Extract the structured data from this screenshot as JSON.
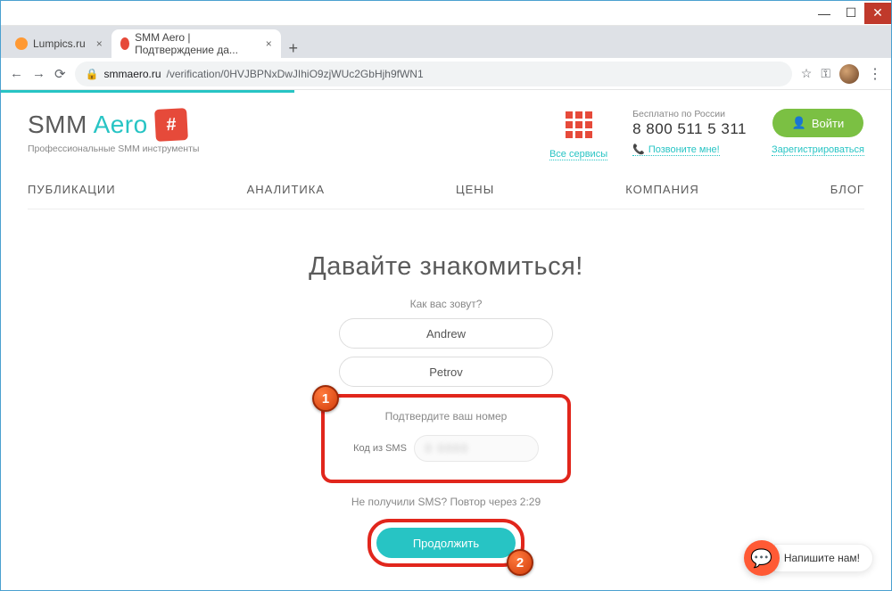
{
  "window": {
    "tabs": [
      {
        "title": "Lumpics.ru",
        "favicon": "orange",
        "active": false
      },
      {
        "title": "SMM Aero | Подтверждение да...",
        "favicon": "red",
        "active": true
      }
    ]
  },
  "address": {
    "domain": "smmaero.ru",
    "path": "/verification/0HVJBPNxDwJIhiO9zjWUc2GbHjh9fWN1"
  },
  "brand": {
    "name_a": "SMM",
    "name_b": "Aero",
    "hash": "#",
    "tagline": "Профессиональные SMM инструменты"
  },
  "services": {
    "link": "Все сервисы"
  },
  "phone": {
    "free_label": "Бесплатно по России",
    "number": "8 800 511 5 311",
    "call_me": "Позвоните мне!"
  },
  "auth": {
    "login": "Войти",
    "register": "Зарегистрироваться"
  },
  "nav": {
    "pub": "ПУБЛИКАЦИИ",
    "ana": "АНАЛИТИКА",
    "price": "ЦЕНЫ",
    "comp": "КОМПАНИЯ",
    "blog": "БЛОГ"
  },
  "form": {
    "hero": "Давайте знакомиться!",
    "question": "Как вас зовут?",
    "first_name": "Andrew",
    "last_name": "Petrov",
    "verify_label": "Подтвердите ваш номер",
    "sms_label": "Код из SMS",
    "sms_value": "0 0000",
    "repeat": "Не получили SMS? Повтор через 2:29",
    "continue": "Продолжить"
  },
  "annotations": {
    "one": "1",
    "two": "2"
  },
  "chat": {
    "label": "Напишите нам!"
  }
}
